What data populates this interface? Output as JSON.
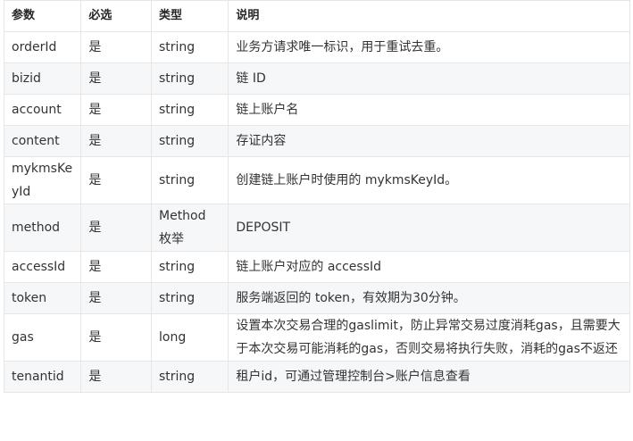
{
  "table": {
    "headers": {
      "param": "参数",
      "required": "必选",
      "type": "类型",
      "desc": "说明"
    },
    "rows": [
      {
        "param": "orderId",
        "required": "是",
        "type": "string",
        "desc": "业务方请求唯一标识，用于重试去重。"
      },
      {
        "param": "bizid",
        "required": "是",
        "type": "string",
        "desc": "链 ID"
      },
      {
        "param": "account",
        "required": "是",
        "type": "string",
        "desc": "链上账户名"
      },
      {
        "param": "content",
        "required": "是",
        "type": "string",
        "desc": "存证内容"
      },
      {
        "param": "mykmsKeyId",
        "required": "是",
        "type": "string",
        "desc": "创建链上账户时使用的 mykmsKeyId。"
      },
      {
        "param": "method",
        "required": "是",
        "type": "Method 枚举",
        "desc": "DEPOSIT"
      },
      {
        "param": "accessId",
        "required": "是",
        "type": "string",
        "desc": "链上账户对应的 accessId"
      },
      {
        "param": "token",
        "required": "是",
        "type": "string",
        "desc": "服务端返回的 token，有效期为30分钟。"
      },
      {
        "param": "gas",
        "required": "是",
        "type": "long",
        "desc": "设置本次交易合理的gaslimit，防止异常交易过度消耗gas，且需要大于本次交易可能消耗的gas，否则交易将执行失败，消耗的gas不返还"
      },
      {
        "param": "tenantid",
        "required": "是",
        "type": "string",
        "desc": "租户id，可通过管理控制台>账户信息查看"
      }
    ]
  }
}
